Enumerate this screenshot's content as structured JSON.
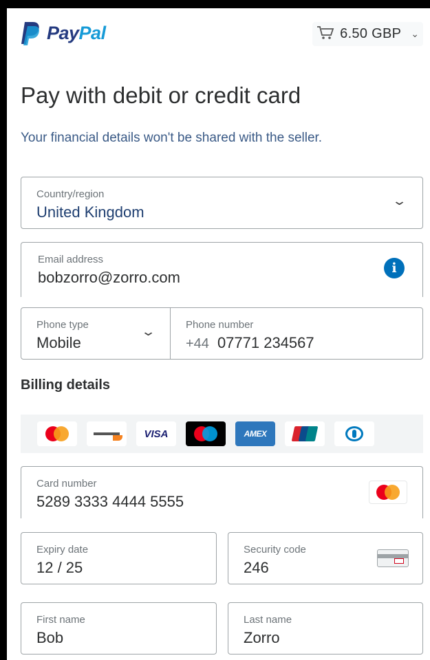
{
  "header": {
    "brand_part1": "Pay",
    "brand_part2": "Pal",
    "cart_icon": "cart-icon",
    "amount": "6.50 GBP",
    "colors": {
      "brand_dark": "#253b80",
      "brand_light": "#179bd7"
    }
  },
  "page": {
    "title": "Pay with debit or credit card",
    "subtitle": "Your financial details won't be shared with the seller."
  },
  "country": {
    "label": "Country/region",
    "value": "United Kingdom"
  },
  "email": {
    "label": "Email address",
    "value": "bobzorro@zorro.com",
    "info_icon": "info-icon"
  },
  "phone_type": {
    "label": "Phone type",
    "value": "Mobile"
  },
  "phone_number": {
    "label": "Phone number",
    "prefix": "+44",
    "value": "07771 234567"
  },
  "billing": {
    "title": "Billing details",
    "brands": [
      "Mastercard",
      "Discover",
      "VISA",
      "Maestro",
      "American Express",
      "UnionPay",
      "Diners Club"
    ]
  },
  "card_number": {
    "label": "Card number",
    "value": "5289 3333 4444 5555"
  },
  "expiry": {
    "label": "Expiry date",
    "value": "12 / 25"
  },
  "security": {
    "label": "Security code",
    "value": "246"
  },
  "first_name": {
    "label": "First name",
    "value": "Bob"
  },
  "last_name": {
    "label": "Last name",
    "value": "Zorro"
  }
}
